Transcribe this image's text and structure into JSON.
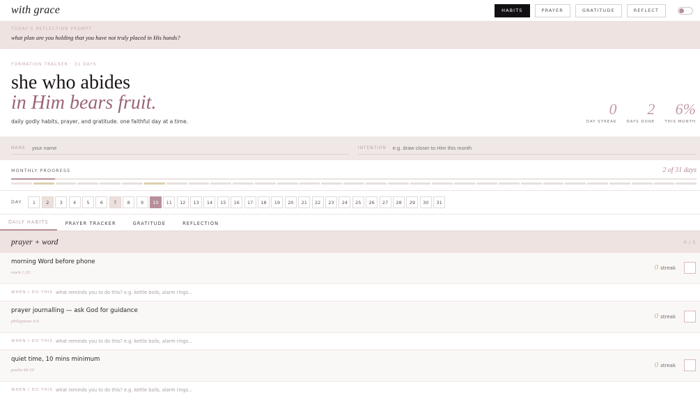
{
  "app": {
    "logo": "with grace"
  },
  "nav": {
    "buttons": [
      {
        "label": "HABITS",
        "active": true
      },
      {
        "label": "PRAYER",
        "active": false
      },
      {
        "label": "GRATITUDE",
        "active": false
      },
      {
        "label": "REFLECT",
        "active": false
      }
    ]
  },
  "prompt": {
    "label": "TODAY'S REFLECTION PROMPT",
    "text": "what plan are you holding that you have not truly placed in His hands?"
  },
  "hero": {
    "label": "FORMATION TRACKER · 31 DAYS",
    "title_line1": "she who abides",
    "title_line2": "in Him bears fruit.",
    "subtitle": "daily godly habits, prayer, and gratitude. one faithful day at a time."
  },
  "stats": [
    {
      "value": "0",
      "caption": "DAY STREAK"
    },
    {
      "value": "2",
      "caption": "DAYS DONE"
    },
    {
      "value": "6%",
      "caption": "THIS MONTH"
    }
  ],
  "fields": {
    "name_label": "NAME",
    "name_placeholder": "your name",
    "intention_label": "INTENTION",
    "intention_placeholder": "e.g. draw closer to Him this month"
  },
  "progress": {
    "label": "MONTHLY PROGRESS",
    "count": "2 of 31 days",
    "fraction": 0.0645,
    "segments_total": 31,
    "segments_done": [
      2,
      7
    ]
  },
  "days": {
    "label": "DAY",
    "items": [
      "1",
      "2",
      "3",
      "4",
      "5",
      "6",
      "7",
      "8",
      "9",
      "10",
      "11",
      "12",
      "13",
      "14",
      "15",
      "16",
      "17",
      "18",
      "19",
      "20",
      "21",
      "22",
      "23",
      "24",
      "25",
      "26",
      "27",
      "28",
      "29",
      "30",
      "31"
    ],
    "done": [
      2,
      7
    ],
    "current": 10
  },
  "tabs": [
    {
      "label": "DAILY HABITS",
      "active": true
    },
    {
      "label": "PRAYER TRACKER",
      "active": false
    },
    {
      "label": "GRATITUDE",
      "active": false
    },
    {
      "label": "REFLECTION",
      "active": false
    }
  ],
  "section": {
    "title": "prayer + word",
    "count": "0 / 5"
  },
  "habits": [
    {
      "name": "morning Word before phone",
      "ref": "mark 1:35",
      "streak_num": "0",
      "streak_label": "streak",
      "trigger_label": "WHEN I DO THIS",
      "trigger_placeholder": "what reminds you to do this? e.g. kettle boils, alarm rings..."
    },
    {
      "name": "prayer journalling — ask God for guidance",
      "ref": "philippians 4:6",
      "streak_num": "0",
      "streak_label": "streak",
      "trigger_label": "WHEN I DO THIS",
      "trigger_placeholder": "what reminds you to do this? e.g. kettle boils, alarm rings..."
    },
    {
      "name": "quiet time, 10 mins minimum",
      "ref": "psalm 46:10",
      "streak_num": "0",
      "streak_label": "streak",
      "trigger_label": "WHEN I DO THIS",
      "trigger_placeholder": "what reminds you to do this? e.g. kettle boils, alarm rings..."
    }
  ],
  "colors": {
    "accent": "#b88f9a",
    "dark": "#121012",
    "band": "#efe3e1",
    "gold": "#c9b48a"
  }
}
